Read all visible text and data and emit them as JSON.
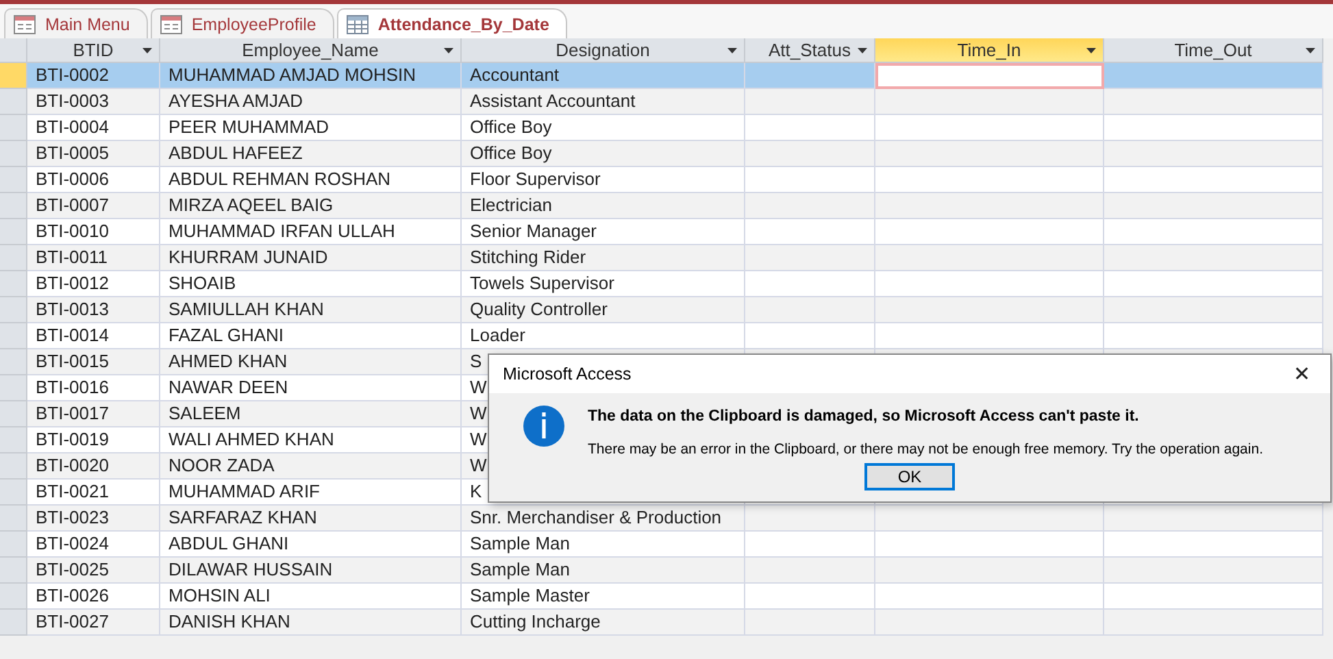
{
  "tabs": [
    {
      "label": "Main Menu",
      "kind": "form",
      "selected": false
    },
    {
      "label": "EmployeeProfile",
      "kind": "form",
      "selected": false
    },
    {
      "label": "Attendance_By_Date",
      "kind": "table",
      "selected": true
    }
  ],
  "table": {
    "columns": [
      {
        "label": "BTID",
        "selected": false
      },
      {
        "label": "Employee_Name",
        "selected": false
      },
      {
        "label": "Designation",
        "selected": false
      },
      {
        "label": "Att_Status",
        "selected": false
      },
      {
        "label": "Time_In",
        "selected": true
      },
      {
        "label": "Time_Out",
        "selected": false
      }
    ],
    "rows": [
      {
        "selected": true,
        "cells": [
          "BTI-0002",
          "MUHAMMAD AMJAD MOHSIN",
          "Accountant",
          "",
          "",
          ""
        ]
      },
      {
        "selected": false,
        "cells": [
          "BTI-0003",
          "AYESHA AMJAD",
          "Assistant Accountant",
          "",
          "",
          ""
        ]
      },
      {
        "selected": false,
        "cells": [
          "BTI-0004",
          "PEER MUHAMMAD",
          "Office Boy",
          "",
          "",
          ""
        ]
      },
      {
        "selected": false,
        "cells": [
          "BTI-0005",
          "ABDUL HAFEEZ",
          "Office Boy",
          "",
          "",
          ""
        ]
      },
      {
        "selected": false,
        "cells": [
          "BTI-0006",
          "ABDUL REHMAN ROSHAN",
          "Floor Supervisor",
          "",
          "",
          ""
        ]
      },
      {
        "selected": false,
        "cells": [
          "BTI-0007",
          "MIRZA AQEEL BAIG",
          "Electrician",
          "",
          "",
          ""
        ]
      },
      {
        "selected": false,
        "cells": [
          "BTI-0010",
          "MUHAMMAD IRFAN ULLAH",
          "Senior Manager",
          "",
          "",
          ""
        ]
      },
      {
        "selected": false,
        "cells": [
          "BTI-0011",
          "KHURRAM JUNAID",
          "Stitching Rider",
          "",
          "",
          ""
        ]
      },
      {
        "selected": false,
        "cells": [
          "BTI-0012",
          "SHOAIB",
          "Towels Supervisor",
          "",
          "",
          ""
        ]
      },
      {
        "selected": false,
        "cells": [
          "BTI-0013",
          "SAMIULLAH KHAN",
          "Quality Controller",
          "",
          "",
          ""
        ]
      },
      {
        "selected": false,
        "cells": [
          "BTI-0014",
          "FAZAL GHANI",
          "Loader",
          "",
          "",
          ""
        ]
      },
      {
        "selected": false,
        "cells": [
          "BTI-0015",
          "AHMED KHAN",
          "S",
          "",
          "",
          ""
        ]
      },
      {
        "selected": false,
        "cells": [
          "BTI-0016",
          "NAWAR DEEN",
          "W"
        ]
      },
      {
        "selected": false,
        "cells": [
          "BTI-0017",
          "SALEEM",
          "W"
        ]
      },
      {
        "selected": false,
        "cells": [
          "BTI-0019",
          "WALI AHMED KHAN",
          "W"
        ]
      },
      {
        "selected": false,
        "cells": [
          "BTI-0020",
          "NOOR ZADA",
          "W"
        ]
      },
      {
        "selected": false,
        "cells": [
          "BTI-0021",
          "MUHAMMAD ARIF",
          "K",
          "",
          "",
          ""
        ]
      },
      {
        "selected": false,
        "cells": [
          "BTI-0023",
          "SARFARAZ KHAN",
          "Snr. Merchandiser & Production",
          "",
          "",
          ""
        ]
      },
      {
        "selected": false,
        "cells": [
          "BTI-0024",
          "ABDUL GHANI",
          "Sample Man",
          "",
          "",
          ""
        ]
      },
      {
        "selected": false,
        "cells": [
          "BTI-0025",
          "DILAWAR HUSSAIN",
          "Sample Man",
          "",
          "",
          ""
        ]
      },
      {
        "selected": false,
        "cells": [
          "BTI-0026",
          "MOHSIN ALI",
          "Sample Master",
          "",
          "",
          ""
        ]
      },
      {
        "selected": false,
        "cells": [
          "BTI-0027",
          "DANISH KHAN",
          "Cutting Incharge",
          "",
          "",
          ""
        ]
      }
    ]
  },
  "dialog": {
    "title": "Microsoft Access",
    "close": "✕",
    "heading": "The data on the Clipboard is damaged, so Microsoft Access can't paste it.",
    "message": "There may be an error in the Clipboard, or there may not be enough free memory. Try the operation again.",
    "buttons": [
      "OK"
    ]
  }
}
